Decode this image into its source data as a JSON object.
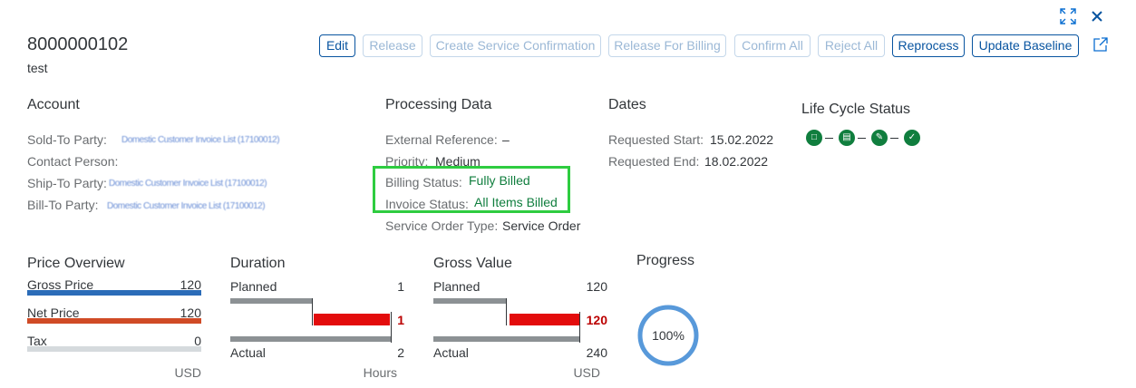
{
  "header": {
    "title": "8000000102",
    "subtitle": "test",
    "expand_icon": "expand-icon",
    "close_icon": "close-icon",
    "share_icon": "share-icon"
  },
  "toolbar": {
    "edit": "Edit",
    "release": "Release",
    "create_service_confirmation": "Create Service Confirmation",
    "release_for_billing": "Release For Billing",
    "confirm_all": "Confirm All",
    "reject_all": "Reject All",
    "reprocess": "Reprocess",
    "update_baseline": "Update Baseline"
  },
  "account": {
    "title": "Account",
    "sold_to_label": "Sold-To Party:",
    "sold_to_value": "Domestic Customer Invoice List (17100012)",
    "contact_label": "Contact Person:",
    "ship_to_label": "Ship-To Party:",
    "ship_to_value": "Domestic Customer Invoice List (17100012)",
    "bill_to_label": "Bill-To Party:",
    "bill_to_value": "Domestic Customer Invoice List (17100012)"
  },
  "processing": {
    "title": "Processing Data",
    "ext_ref_label": "External Reference:",
    "ext_ref_value": "–",
    "priority_label": "Priority:",
    "priority_value": "Medium",
    "billing_status_label": "Billing Status:",
    "billing_status_value": "Fully Billed",
    "invoice_status_label": "Invoice Status:",
    "invoice_status_value": "All Items Billed",
    "order_type_label": "Service Order Type:",
    "order_type_value": "Service Order"
  },
  "dates": {
    "title": "Dates",
    "req_start_label": "Requested Start:",
    "req_start_value": "15.02.2022",
    "req_end_label": "Requested End:",
    "req_end_value": "18.02.2022"
  },
  "lifecycle": {
    "title": "Life Cycle Status",
    "steps": [
      "open-icon",
      "document-icon",
      "approval-icon",
      "check-icon"
    ]
  },
  "price_overview": {
    "title": "Price Overview",
    "gross_label": "Gross Price",
    "gross_value": "120",
    "net_label": "Net Price",
    "net_value": "120",
    "tax_label": "Tax",
    "tax_value": "0",
    "unit": "USD",
    "colors": {
      "gross": "#2b6cb8",
      "net": "#d04b26",
      "tax": "#d5dadd"
    }
  },
  "duration": {
    "title": "Duration",
    "planned_label": "Planned",
    "planned_value": "1",
    "diff_value": "1",
    "actual_label": "Actual",
    "actual_value": "2",
    "unit": "Hours"
  },
  "gross_value": {
    "title": "Gross Value",
    "planned_label": "Planned",
    "planned_value": "120",
    "diff_value": "120",
    "actual_label": "Actual",
    "actual_value": "240",
    "unit": "USD"
  },
  "progress": {
    "title": "Progress",
    "value": "100%",
    "color": "#5899da"
  }
}
